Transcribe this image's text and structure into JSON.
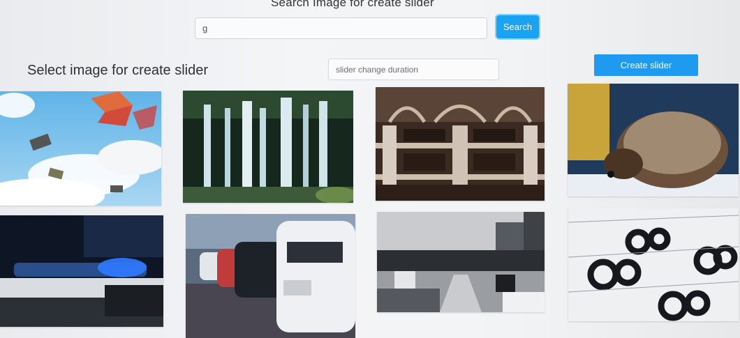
{
  "search": {
    "title": "Search Image for create slider",
    "query": "g",
    "button_label": "Search"
  },
  "slider": {
    "heading": "Select image for create slider",
    "duration_placeholder": "slider change duration",
    "create_button_label": "Create slider"
  },
  "colors": {
    "accent": "#1aa3f2"
  },
  "images": [
    {
      "subject": "sky-with-kites-and-figures"
    },
    {
      "subject": "waterfall"
    },
    {
      "subject": "library-interior"
    },
    {
      "subject": "hedgehog"
    },
    {
      "subject": "police-car-lights"
    },
    {
      "subject": "parked-cars"
    },
    {
      "subject": "street-protest"
    },
    {
      "subject": "typography-letter-g"
    }
  ]
}
